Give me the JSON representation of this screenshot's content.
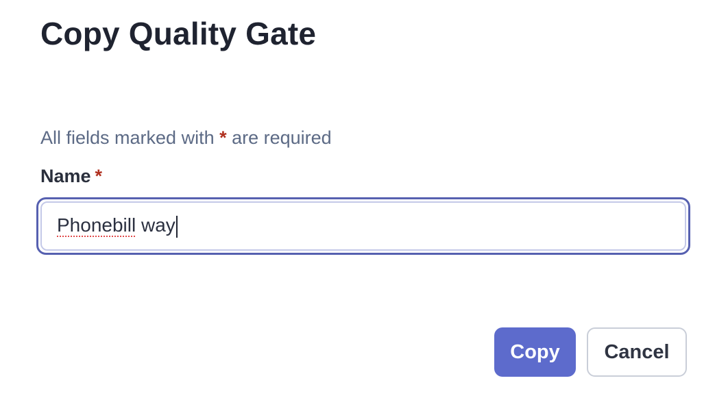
{
  "dialog": {
    "title": "Copy Quality Gate",
    "required_note_prefix": "All fields marked with ",
    "required_marker": "*",
    "required_note_suffix": " are required"
  },
  "name_field": {
    "label": "Name",
    "required_marker": "*",
    "value_misspelled_part": "Phonebill",
    "value_rest": " way"
  },
  "actions": {
    "copy_label": "Copy",
    "cancel_label": "Cancel"
  },
  "colors": {
    "primary": "#5d6bcc",
    "focus_ring": "#5660b0",
    "required": "#b0301f",
    "muted_text": "#5c6a85"
  }
}
